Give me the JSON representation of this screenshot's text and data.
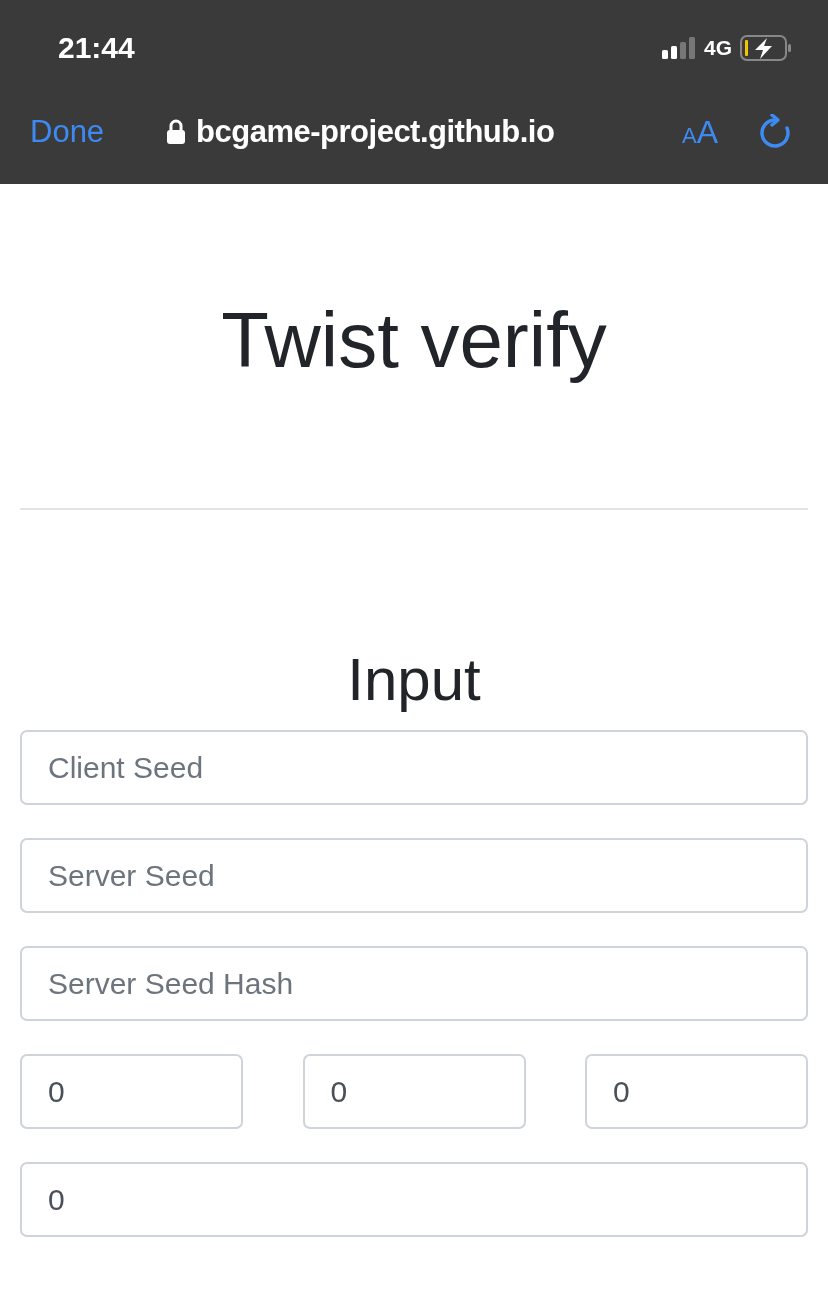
{
  "status_bar": {
    "time": "21:44",
    "network": "4G"
  },
  "browser_bar": {
    "done": "Done",
    "url": "bcgame-project.github.io",
    "text_size": {
      "small": "A",
      "large": "A"
    }
  },
  "page": {
    "title": "Twist verify",
    "section": "Input",
    "fields": [
      {
        "placeholder": "Client Seed"
      },
      {
        "placeholder": "Server Seed"
      },
      {
        "placeholder": "Server Seed Hash"
      }
    ],
    "number_row": [
      {
        "value": "0"
      },
      {
        "value": "0"
      },
      {
        "value": "0"
      }
    ],
    "last_field": {
      "value": "0"
    }
  }
}
